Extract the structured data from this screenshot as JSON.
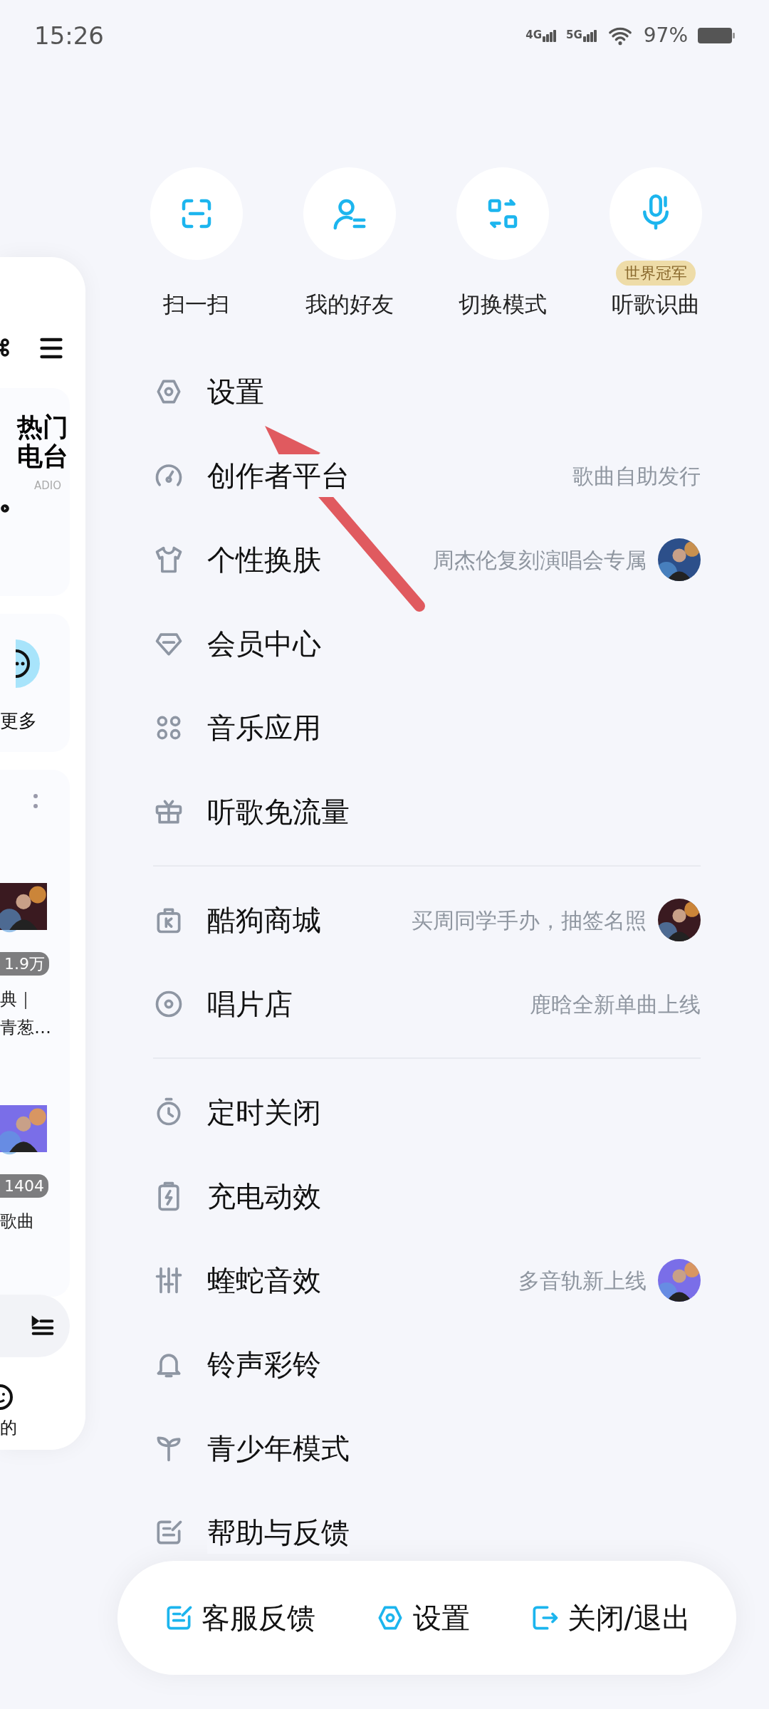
{
  "status_bar": {
    "time": "15:26",
    "networks": [
      "4G",
      "5G"
    ],
    "battery": "97%"
  },
  "quick_actions": [
    {
      "label": "扫一扫",
      "kind": "scan"
    },
    {
      "label": "我的好友",
      "kind": "friends"
    },
    {
      "label": "切换模式",
      "kind": "switch"
    },
    {
      "label": "听歌识曲",
      "kind": "mic",
      "badge": "世界冠军"
    }
  ],
  "menu_groups": [
    [
      {
        "label": "设置",
        "kind": "settings"
      },
      {
        "label": "创作者平台",
        "kind": "creator",
        "hint": "歌曲自助发行"
      },
      {
        "label": "个性换肤",
        "kind": "shirt",
        "hint": "周杰伦复刻演唱会专属"
      },
      {
        "label": "会员中心",
        "kind": "diamond"
      },
      {
        "label": "音乐应用",
        "kind": "apps"
      },
      {
        "label": "听歌免流量",
        "kind": "gift"
      }
    ],
    [
      {
        "label": "酷狗商城",
        "kind": "bag",
        "hint": "买周同学手办，抽签名照"
      },
      {
        "label": "唱片店",
        "kind": "disc",
        "hint": "鹿晗全新单曲上线"
      }
    ],
    [
      {
        "label": "定时关闭",
        "kind": "timer"
      },
      {
        "label": "充电动效",
        "kind": "charge"
      },
      {
        "label": "蝰蛇音效",
        "kind": "sliders",
        "hint": "多音轨新上线"
      },
      {
        "label": "铃声彩铃",
        "kind": "bell"
      },
      {
        "label": "青少年模式",
        "kind": "sprout"
      },
      {
        "label": "帮助与反馈",
        "kind": "feedback"
      }
    ]
  ],
  "bottom_bar": [
    {
      "label": "客服反馈",
      "kind": "feedback"
    },
    {
      "label": "设置",
      "kind": "settings"
    },
    {
      "label": "关闭/退出",
      "kind": "exit"
    }
  ],
  "side_panel": {
    "card_title_lines": [
      "热门",
      "电台"
    ],
    "card_subtitle": "ADIO",
    "more_label": "更多",
    "playlists": [
      {
        "badge": "1.9万",
        "title_lines": [
          "典｜",
          "青葱…"
        ]
      },
      {
        "badge": "1404",
        "title_lines": [
          "歌曲"
        ]
      }
    ],
    "tab_label": "的"
  }
}
